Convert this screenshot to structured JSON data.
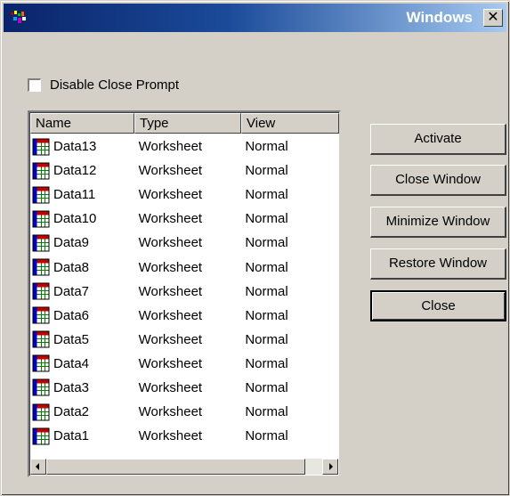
{
  "window": {
    "title": "Windows",
    "close_glyph": "✕",
    "app_icon": "origin-app-icon"
  },
  "options": {
    "disable_close_prompt_label": "Disable Close Prompt",
    "disable_close_prompt_checked": false
  },
  "list": {
    "columns": [
      "Name",
      "Type",
      "View"
    ],
    "row_icon": "worksheet-icon",
    "rows": [
      {
        "name": "Data13",
        "type": "Worksheet",
        "view": "Normal"
      },
      {
        "name": "Data12",
        "type": "Worksheet",
        "view": "Normal"
      },
      {
        "name": "Data11",
        "type": "Worksheet",
        "view": "Normal"
      },
      {
        "name": "Data10",
        "type": "Worksheet",
        "view": "Normal"
      },
      {
        "name": "Data9",
        "type": "Worksheet",
        "view": "Normal"
      },
      {
        "name": "Data8",
        "type": "Worksheet",
        "view": "Normal"
      },
      {
        "name": "Data7",
        "type": "Worksheet",
        "view": "Normal"
      },
      {
        "name": "Data6",
        "type": "Worksheet",
        "view": "Normal"
      },
      {
        "name": "Data5",
        "type": "Worksheet",
        "view": "Normal"
      },
      {
        "name": "Data4",
        "type": "Worksheet",
        "view": "Normal"
      },
      {
        "name": "Data3",
        "type": "Worksheet",
        "view": "Normal"
      },
      {
        "name": "Data2",
        "type": "Worksheet",
        "view": "Normal"
      },
      {
        "name": "Data1",
        "type": "Worksheet",
        "view": "Normal"
      }
    ]
  },
  "buttons": {
    "activate": "Activate",
    "close_window": "Close Window",
    "minimize_window": "Minimize Window",
    "restore_window": "Restore Window",
    "close": "Close"
  },
  "colors": {
    "titlebar_start": "#0a246a",
    "titlebar_end": "#a6caf0",
    "face": "#d4d0c8"
  }
}
